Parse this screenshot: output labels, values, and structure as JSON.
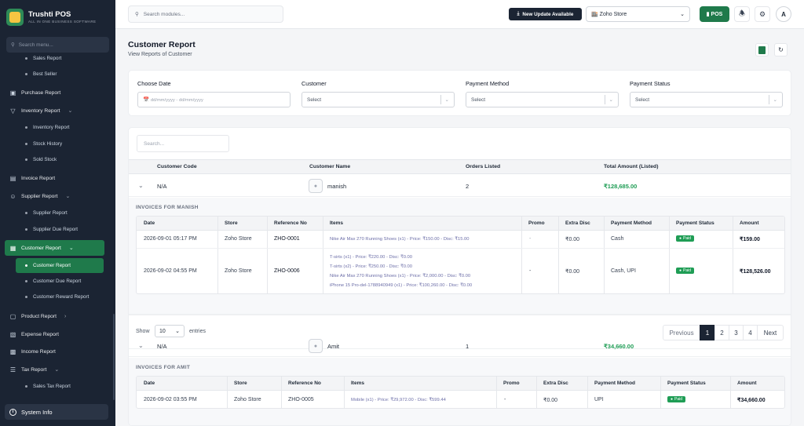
{
  "brand": {
    "name": "Trushti POS",
    "tagline": "ALL IN ONE BUSINESS SOFTWARE"
  },
  "sidebar": {
    "search_placeholder": "Search menu...",
    "items": [
      {
        "label": "Sales Report",
        "type": "sub"
      },
      {
        "label": "Best Seller",
        "type": "sub"
      },
      {
        "label": "Purchase Report",
        "type": "main",
        "icon": "cart-icon"
      },
      {
        "label": "Inventory Report",
        "type": "main",
        "icon": "filter-icon",
        "expandable": true
      },
      {
        "label": "Inventory Report",
        "type": "sub"
      },
      {
        "label": "Stock History",
        "type": "sub"
      },
      {
        "label": "Sold Stock",
        "type": "sub"
      },
      {
        "label": "Invoice Report",
        "type": "main",
        "icon": "receipt-icon"
      },
      {
        "label": "Supplier Report",
        "type": "main",
        "icon": "users-icon",
        "expandable": true
      },
      {
        "label": "Supplier Report",
        "type": "sub"
      },
      {
        "label": "Supplier Due Report",
        "type": "sub"
      },
      {
        "label": "Customer Report",
        "type": "main",
        "icon": "customer-icon",
        "expandable": true,
        "active": true
      },
      {
        "label": "Customer Report",
        "type": "sub",
        "active": true
      },
      {
        "label": "Customer Due Report",
        "type": "sub"
      },
      {
        "label": "Customer Reward Report",
        "type": "sub"
      },
      {
        "label": "Product Report",
        "type": "main",
        "icon": "box-icon",
        "expandable": true
      },
      {
        "label": "Expense Report",
        "type": "main",
        "icon": "expense-icon"
      },
      {
        "label": "Income Report",
        "type": "main",
        "icon": "income-icon"
      },
      {
        "label": "Tax Report",
        "type": "main",
        "icon": "tax-icon",
        "expandable": true
      },
      {
        "label": "Sales Tax Report",
        "type": "sub"
      }
    ],
    "system_info": "System Info"
  },
  "topbar": {
    "search_placeholder": "Search modules...",
    "update_label": "New Update Available",
    "store_selected": "Zoho Store",
    "pos_label": "POS",
    "avatar_initial": "A"
  },
  "page": {
    "title": "Customer Report",
    "subtitle": "View Reports of Customer"
  },
  "filters": {
    "date_label": "Choose Date",
    "date_placeholder": "dd/mm/yyyy - dd/mm/yyyy",
    "customer_label": "Customer",
    "customer_value": "Select",
    "payment_method_label": "Payment Method",
    "payment_method_value": "Select",
    "payment_status_label": "Payment Status",
    "payment_status_value": "Select"
  },
  "report": {
    "search_placeholder": "Search...",
    "columns": [
      "Customer Code",
      "Customer Name",
      "Orders Listed",
      "Total Amount (Listed)"
    ],
    "invoice_columns": [
      "Date",
      "Store",
      "Reference No",
      "Items",
      "Promo",
      "Extra Disc",
      "Payment Method",
      "Payment Status",
      "Amount"
    ],
    "customers": [
      {
        "code": "N/A",
        "name": "manish",
        "orders": "2",
        "total": "₹128,685.00",
        "invoices_title": "INVOICES FOR MANISH",
        "invoices": [
          {
            "date": "2026-09-01 05:17 PM",
            "store": "Zoho Store",
            "ref": "ZHO-0001",
            "items": [
              "Nike Air Max 270 Running Shoes (x1) - Price: ₹150.00 - Disc: ₹15.00"
            ],
            "promo": "-",
            "extra_disc": "₹0.00",
            "method": "Cash",
            "status": "Paid",
            "amount": "₹159.00"
          },
          {
            "date": "2026-09-02 04:55 PM",
            "store": "Zoho Store",
            "ref": "ZHO-0006",
            "items": [
              "T-sirts (x1) - Price: ₹220.00 - Disc: ₹0.00",
              "T-sirts (x2) - Price: ₹250.00 - Disc: ₹0.00",
              "Nike Air Max 270 Running Shoes (x1) - Price: ₹2,000.00 - Disc: ₹0.00",
              "iPhone 15 Pro-del-1788940949 (x1) - Price: ₹100,260.00 - Disc: ₹0.00"
            ],
            "promo": "-",
            "extra_disc": "₹0.00",
            "method": "Cash, UPI",
            "status": "Paid",
            "amount": "₹128,526.00"
          }
        ]
      },
      {
        "code": "N/A",
        "name": "Amit",
        "orders": "1",
        "total": "₹34,660.00",
        "invoices_title": "INVOICES FOR AMIT",
        "invoices": [
          {
            "date": "2026-09-02 03:55 PM",
            "store": "Zoho Store",
            "ref": "ZHO-0005",
            "items": [
              "Mobile (x1) - Price: ₹29,972.00 - Disc: ₹599.44"
            ],
            "promo": "-",
            "extra_disc": "₹0.00",
            "method": "UPI",
            "status": "Paid",
            "amount": "₹34,660.00"
          }
        ]
      }
    ],
    "pager": {
      "show_label": "Show",
      "page_size": "10",
      "entries_label": "entries",
      "previous": "Previous",
      "pages": [
        "1",
        "2",
        "3",
        "4"
      ],
      "next": "Next",
      "current": "1"
    }
  }
}
